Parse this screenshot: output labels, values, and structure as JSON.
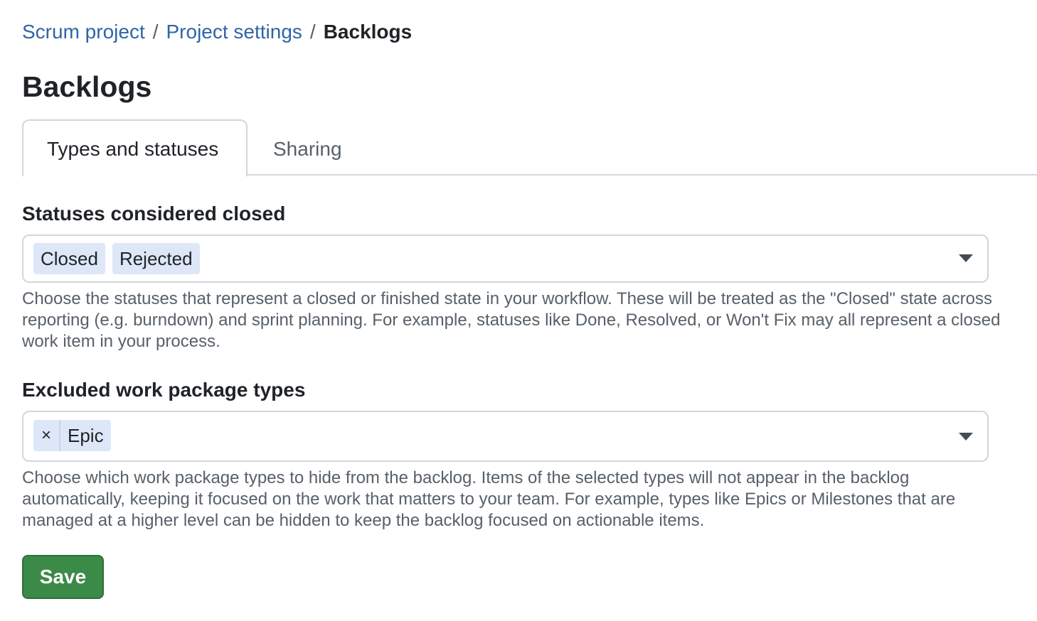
{
  "breadcrumb": {
    "items": [
      "Scrum project",
      "Project settings"
    ],
    "separator": "/",
    "current": "Backlogs"
  },
  "page_title": "Backlogs",
  "tabs": [
    {
      "label": "Types and statuses",
      "active": true
    },
    {
      "label": "Sharing",
      "active": false
    }
  ],
  "closed_statuses": {
    "label": "Statuses considered closed",
    "selected": [
      "Closed",
      "Rejected"
    ],
    "help": "Choose the statuses that represent a closed or finished state in your workflow. These will be treated as the \"Closed\" state across reporting (e.g. burndown) and sprint planning. For example, statuses like Done, Resolved, or Won't Fix may all represent a closed work item in your process."
  },
  "excluded_types": {
    "label": "Excluded work package types",
    "remove_glyph": "×",
    "selected": [
      "Epic"
    ],
    "help": "Choose which work package types to hide from the backlog. Items of the selected types will not appear in the backlog automatically, keeping it focused on the work that matters to your team. For example, types like Epics or Milestones that are managed at a higher level can be hidden to keep the backlog focused on actionable items."
  },
  "save_label": "Save",
  "colors": {
    "link": "#2f65a7",
    "chip": "#dde7f8",
    "save_button": "#3b8a47"
  },
  "icons": {
    "dropdown": "caret-down-icon",
    "remove": "close-icon"
  }
}
